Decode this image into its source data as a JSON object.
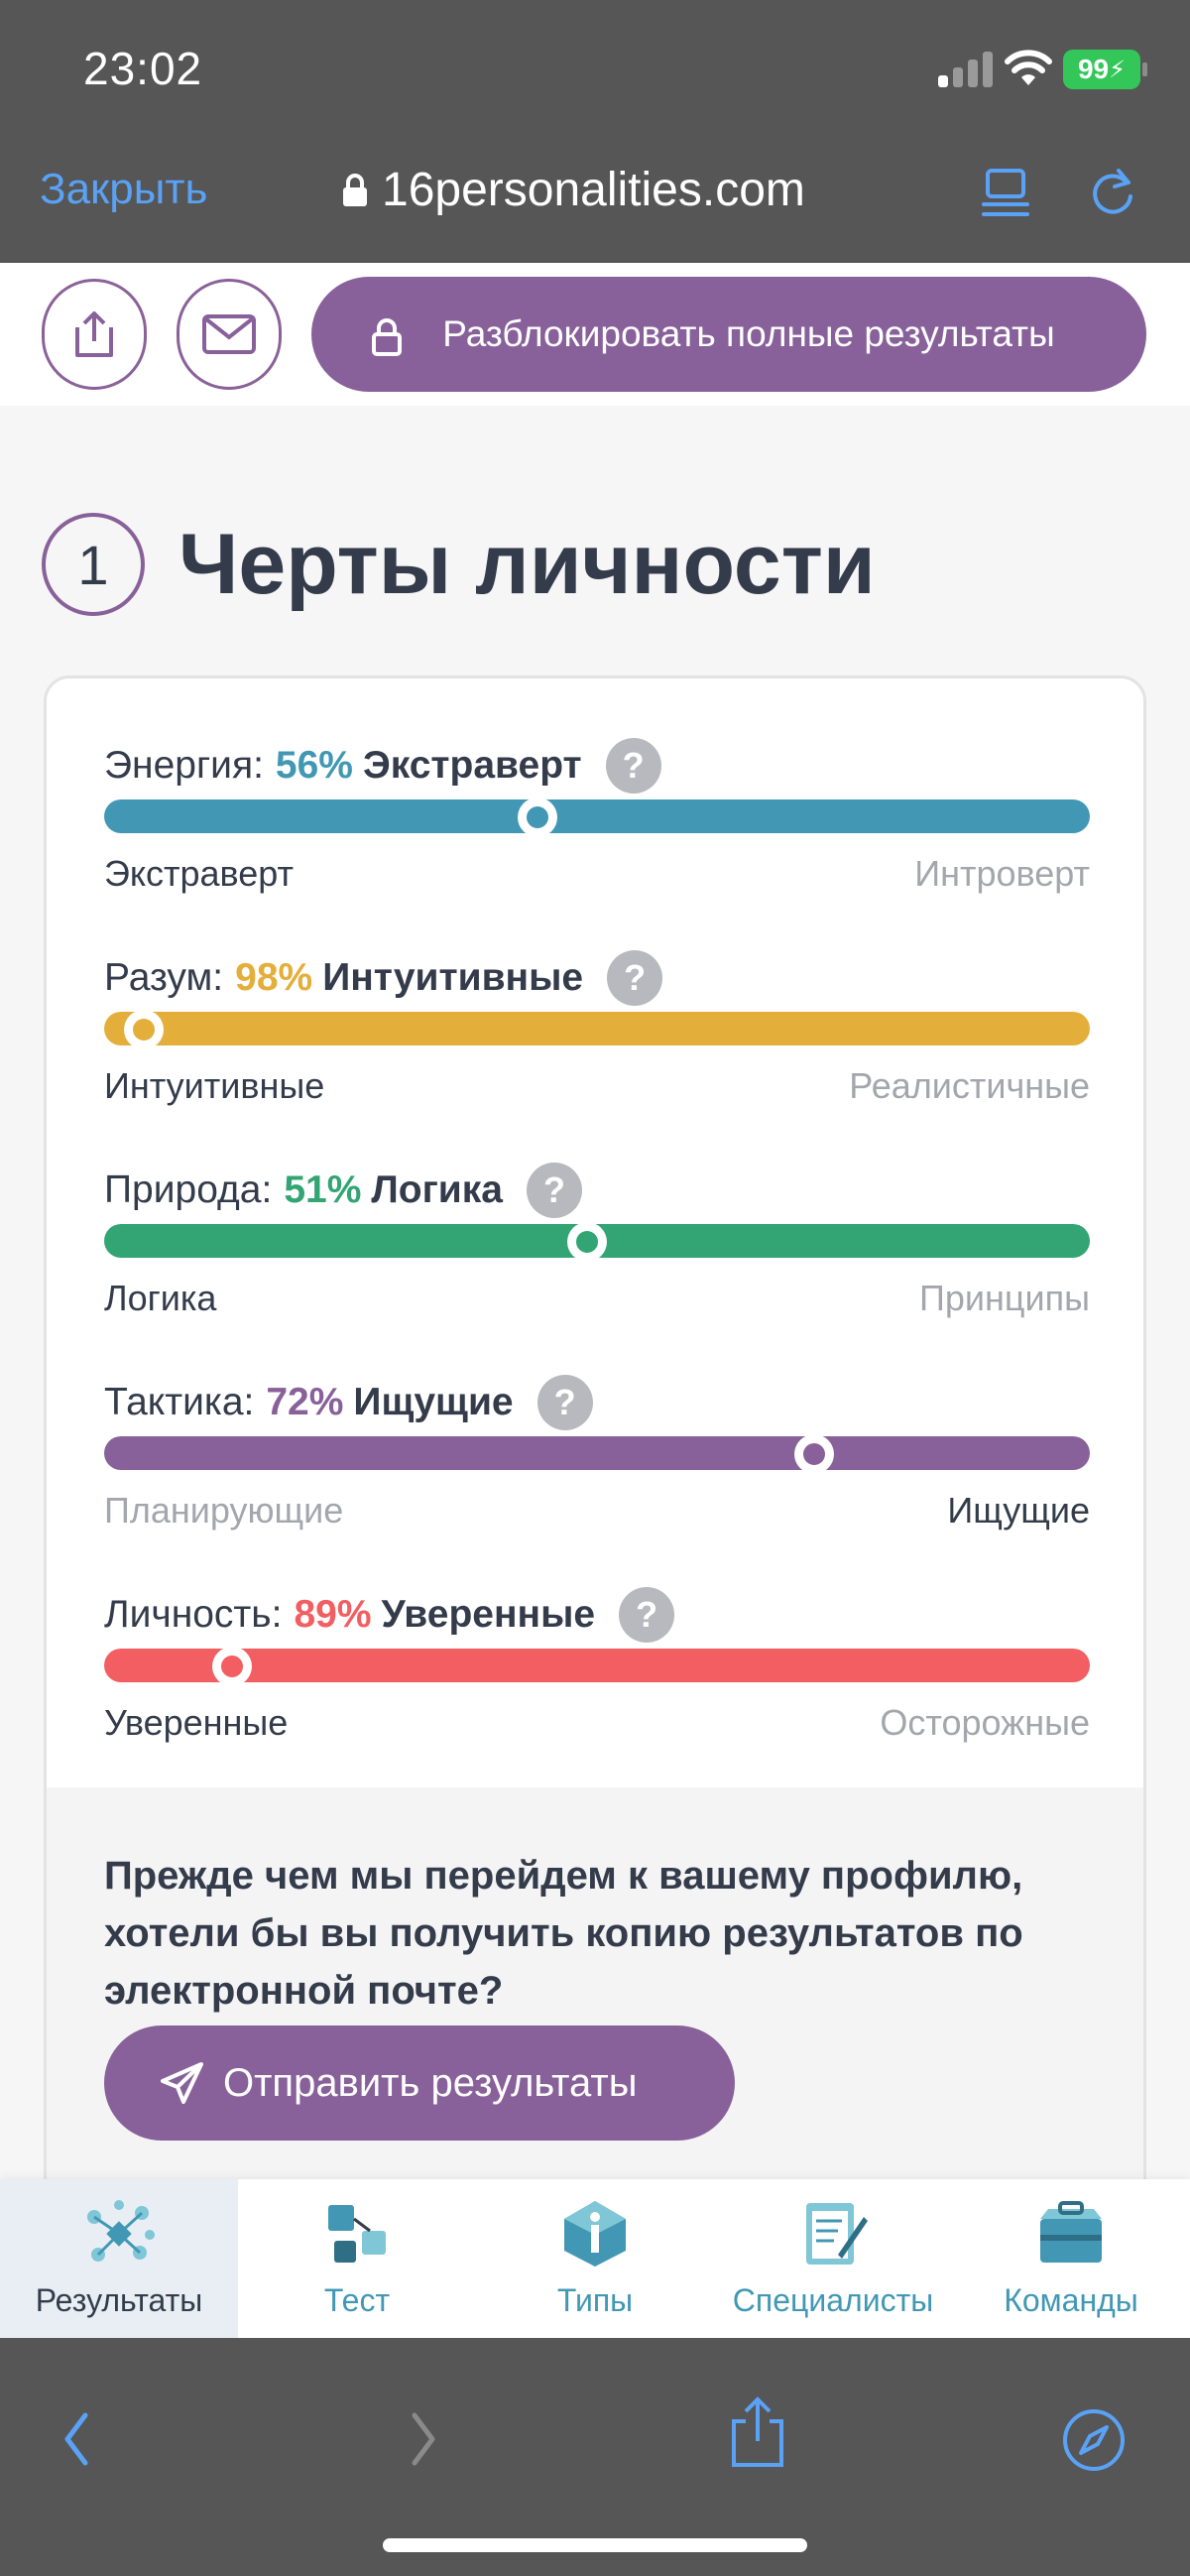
{
  "status": {
    "time": "23:02",
    "battery": "99"
  },
  "browser": {
    "close_label": "Закрыть",
    "url": "16personalities.com"
  },
  "actions": {
    "unlock_label": "Разблокировать полные результаты"
  },
  "section": {
    "number": "1",
    "title": "Черты личности"
  },
  "colors": {
    "energy": "#4298b4",
    "mind": "#e4ae3a",
    "nature": "#33a474",
    "tactics": "#88619a",
    "identity": "#f25e62"
  },
  "traits": [
    {
      "label": "Энергия:",
      "percent": "56%",
      "side": "Экстраверт",
      "left": "Экстраверт",
      "right": "Интроверт",
      "position": 0.44,
      "active": "left"
    },
    {
      "label": "Разум:",
      "percent": "98%",
      "side": "Интуитивные",
      "left": "Интуитивные",
      "right": "Реалистичные",
      "position": 0.04,
      "active": "left"
    },
    {
      "label": "Природа:",
      "percent": "51%",
      "side": "Логика",
      "left": "Логика",
      "right": "Принципы",
      "position": 0.49,
      "active": "left"
    },
    {
      "label": "Тактика:",
      "percent": "72%",
      "side": "Ищущие",
      "left": "Планирующие",
      "right": "Ищущие",
      "position": 0.72,
      "active": "right"
    },
    {
      "label": "Личность:",
      "percent": "89%",
      "side": "Уверенные",
      "left": "Уверенные",
      "right": "Осторожные",
      "position": 0.13,
      "active": "left"
    }
  ],
  "help_symbol": "?",
  "promo": {
    "text": "Прежде чем мы перейдем к вашему профилю, хотели бы вы получить копию результатов по электронной почте?",
    "button": "Отправить результаты"
  },
  "nav": [
    {
      "label": "Результаты",
      "icon": "results-icon",
      "active": true
    },
    {
      "label": "Тест",
      "icon": "test-icon",
      "active": false
    },
    {
      "label": "Типы",
      "icon": "types-icon",
      "active": false
    },
    {
      "label": "Специалисты",
      "icon": "professionals-icon",
      "active": false
    },
    {
      "label": "Команды",
      "icon": "teams-icon",
      "active": false
    }
  ]
}
